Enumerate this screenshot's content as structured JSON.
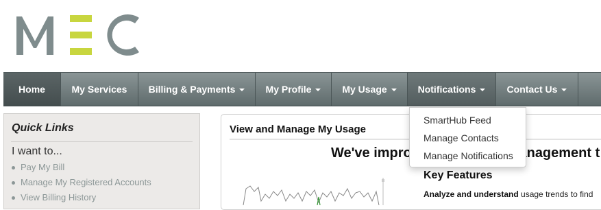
{
  "brand": {
    "logo_text": "MEC",
    "colors": {
      "gray": "#7f8c8d",
      "accent": "#c8d63f"
    }
  },
  "nav": {
    "items": [
      {
        "label": "Home",
        "has_caret": false
      },
      {
        "label": "My Services",
        "has_caret": false
      },
      {
        "label": "Billing & Payments",
        "has_caret": true
      },
      {
        "label": "My Profile",
        "has_caret": true
      },
      {
        "label": "My Usage",
        "has_caret": true
      },
      {
        "label": "Notifications",
        "has_caret": true
      },
      {
        "label": "Contact Us",
        "has_caret": true
      }
    ]
  },
  "dropdown": {
    "items": [
      "SmartHub Feed",
      "Manage Contacts",
      "Manage Notifications"
    ]
  },
  "quick_links": {
    "title": "Quick Links",
    "intro": "I want to...",
    "links": [
      "Pay My Bill",
      "Manage My Registered Accounts",
      "View Billing History"
    ]
  },
  "main": {
    "title": "View and Manage My Usage",
    "headline": "We've improved the usage management t",
    "key_features": "Key Features",
    "analyze_bold": "Analyze and understand",
    "analyze_rest": " usage trends to find"
  }
}
